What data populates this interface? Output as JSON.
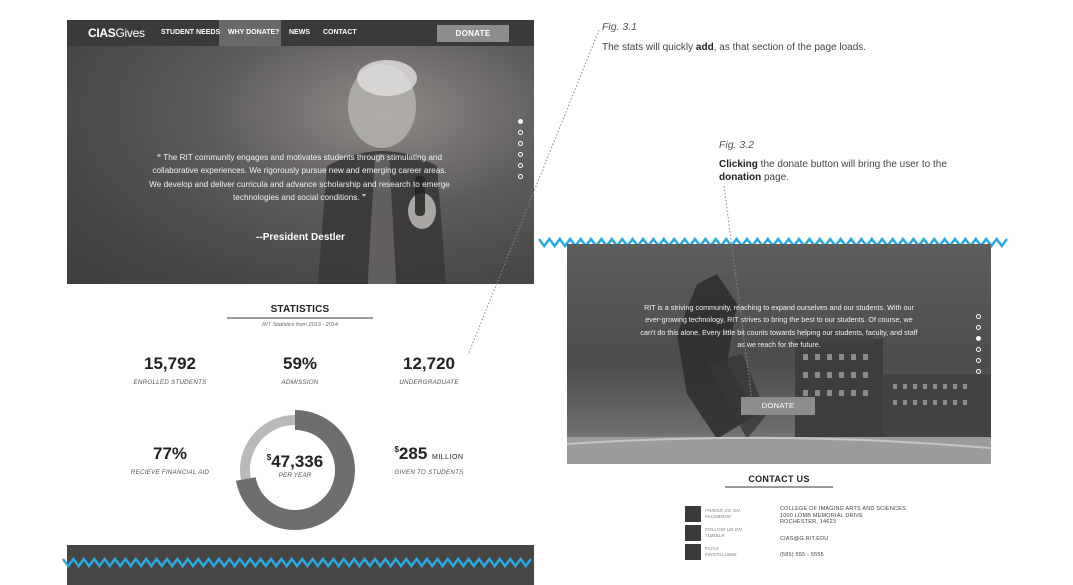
{
  "left_mockup": {
    "nav": {
      "logo_bold": "CIAS",
      "logo_light": "Gives",
      "links": [
        "STUDENT NEEDS",
        "WHY DONATE?",
        "NEWS",
        "CONTACT"
      ],
      "donate_label": "DONATE"
    },
    "hero": {
      "open_quote": "“",
      "quote": "The RIT community engages and motivates students through stimulating and collaborative experiences. We rigorously pursue new and emerging career areas. We develop and deliver curricula and advance scholarship and research to emerge technologies and social conditions.",
      "close_quote": "”",
      "author": "--President Destler",
      "active_slide": 1,
      "slide_count": 6
    },
    "statistics": {
      "title": "STATISTICS",
      "subtitle": "RIT Statistics from 2013 - 2014",
      "items": [
        {
          "value": "15,792",
          "label": "ENROLLED STUDENTS"
        },
        {
          "value": "59%",
          "label": "ADMISSION"
        },
        {
          "value": "12,720",
          "label": "UNDERGRADUATE"
        },
        {
          "value": "77%",
          "label": "RECIEVE FINANCIAL AID"
        }
      ],
      "center": {
        "currency": "$",
        "value": "47,336",
        "label": "PER YEAR",
        "ring_fraction": 0.72
      },
      "given": {
        "currency": "$",
        "value": "285",
        "unit": "MILLION",
        "label": "GIVEN TO STUDENTS"
      }
    }
  },
  "right_mockup": {
    "banner": {
      "text": "RIT is a striving community, reaching to expand ourselves and our students. With our ever-growing technology, RIT strives to bring the best to our students. Of course, we can't do this alone. Every little bit counts towards helping our students, faculty, and staff as we reach for the future.",
      "donate_label": "DONATE",
      "active_slide": 3,
      "slide_count": 6
    },
    "contact": {
      "title": "CONTACT US",
      "social": [
        {
          "line1": "FRIEND US ON",
          "line2": "FACEBOOK"
        },
        {
          "line1": "FOLLOW US ON",
          "line2": "TUMBLR"
        },
        {
          "line1": "#CIAS",
          "line2": "#INSTALUMNI"
        }
      ],
      "address": [
        "COLLEGE OF IMAGING ARTS AND SCIENCES",
        "1000 LOMB MEMORIAL DRIVE",
        "ROCHESTER, 14623"
      ],
      "email": "CIAS@G.RIT.EDU",
      "phone": "(585) 555 - 5555"
    }
  },
  "annotations": {
    "fig1": {
      "title": "Fig. 3.1",
      "before": "The stats will quickly ",
      "bold": "add",
      "after": ", as that section of the page loads."
    },
    "fig2": {
      "title": "Fig. 3.2",
      "bold1": "Clicking",
      "middle": " the donate button will bring the user to the ",
      "bold2": "donation",
      "after": " page."
    }
  },
  "colors": {
    "nav_dark": "#3b3a39",
    "button_gray": "#8f8d8c",
    "zigzag_blue": "#29a9e0",
    "donut_dark": "#6f6e6d",
    "donut_light": "#b9b9b9"
  }
}
